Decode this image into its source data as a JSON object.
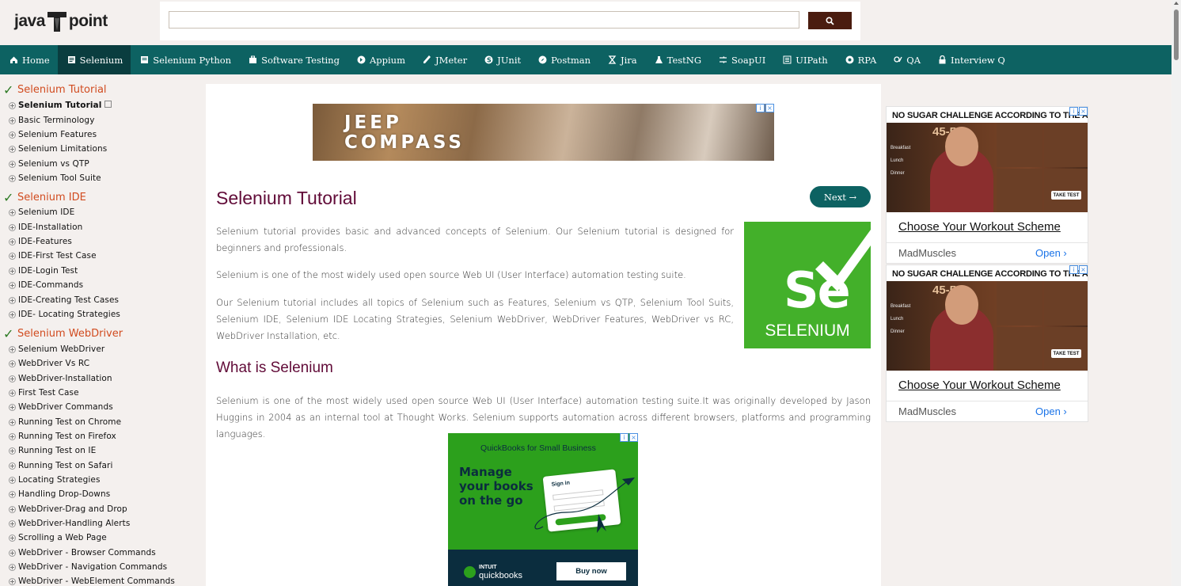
{
  "logo": {
    "left": "java",
    "right": "point"
  },
  "search": {
    "value": "",
    "placeholder": ""
  },
  "nav": [
    {
      "label": "Home",
      "icon": "home-icon"
    },
    {
      "label": "Selenium",
      "icon": "document-icon"
    },
    {
      "label": "Selenium Python",
      "icon": "document-icon"
    },
    {
      "label": "Software Testing",
      "icon": "briefcase-icon"
    },
    {
      "label": "Appium",
      "icon": "circle-arrow-icon"
    },
    {
      "label": "JMeter",
      "icon": "pen-icon"
    },
    {
      "label": "JUnit",
      "icon": "circle-s-icon"
    },
    {
      "label": "Postman",
      "icon": "compass-icon"
    },
    {
      "label": "Jira",
      "icon": "hourglass-icon"
    },
    {
      "label": "TestNG",
      "icon": "flask-icon"
    },
    {
      "label": "SoapUI",
      "icon": "shuffle-icon"
    },
    {
      "label": "UIPath",
      "icon": "list-icon"
    },
    {
      "label": "RPA",
      "icon": "gear-circle-icon"
    },
    {
      "label": "QA",
      "icon": "qa-icon"
    },
    {
      "label": "Interview Q",
      "icon": "lock-icon"
    }
  ],
  "sidebar": {
    "sections": [
      {
        "title": "Selenium Tutorial",
        "items": [
          "Selenium Tutorial",
          "Basic Terminology",
          "Selenium Features",
          "Selenium Limitations",
          "Selenium vs QTP",
          "Selenium Tool Suite"
        ]
      },
      {
        "title": "Selenium IDE",
        "items": [
          "Selenium IDE",
          "IDE-Installation",
          "IDE-Features",
          "IDE-First Test Case",
          "IDE-Login Test",
          "IDE-Commands",
          "IDE-Creating Test Cases",
          "IDE- Locating Strategies"
        ]
      },
      {
        "title": "Selenium WebDriver",
        "items": [
          "Selenium WebDriver",
          "WebDriver Vs RC",
          "WebDriver-Installation",
          "First Test Case",
          "WebDriver Commands",
          "Running Test on Chrome",
          "Running Test on Firefox",
          "Running Test on IE",
          "Running Test on Safari",
          "Locating Strategies",
          "Handling Drop-Downs",
          "WebDriver-Drag and Drop",
          "WebDriver-Handling Alerts",
          "Scrolling a Web Page",
          "WebDriver - Browser Commands",
          "WebDriver - Navigation Commands",
          "WebDriver - WebElement Commands"
        ]
      }
    ]
  },
  "main": {
    "ad_top": {
      "line1": "JEEP",
      "line2": "COMPASS"
    },
    "title": "Selenium Tutorial",
    "next_label": "Next →",
    "paragraphs": [
      "Selenium tutorial provides basic and advanced concepts of Selenium. Our Selenium tutorial is designed for beginners and professionals.",
      "Selenium is one of the most widely used open source Web UI (User Interface) automation testing suite.",
      "Our Selenium tutorial includes all topics of Selenium such as Features, Selenium vs QTP, Selenium Tool Suits, Selenium IDE, Selenium IDE Locating Strategies, Selenium WebDriver, WebDriver Features, WebDriver vs RC, WebDriver Installation, etc."
    ],
    "logo_mark": "Se",
    "logo_word": "SELENIUM",
    "subtitle": "What is Selenium",
    "paragraph_what": "Selenium is one of the most widely used open source Web UI (User Interface) automation testing suite.It was originally developed by Jason Huggins in 2004 as an internal tool at Thought Works. Selenium supports automation across different browsers, platforms and programming languages.",
    "ad_qb": {
      "top": "QuickBooks for Small Business",
      "headline": "Manage your books on the go",
      "card_title": "Sign in",
      "brand_line1": "INTUIT",
      "brand_line2": "quickbooks",
      "buy": "Buy now"
    }
  },
  "right_ads": [
    {
      "title": "NO SUGAR CHALLENGE ACCORDING TO THE AGE",
      "range": "45-55",
      "menu": [
        "Breakfast",
        "Lunch",
        "Dinner"
      ],
      "cta_badge": "TAKE TEST",
      "link": "Choose Your Workout Scheme",
      "brand": "MadMuscles",
      "open": "Open ›"
    },
    {
      "title": "NO SUGAR CHALLENGE ACCORDING TO THE AGE",
      "range": "45-55",
      "menu": [
        "Breakfast",
        "Lunch",
        "Dinner"
      ],
      "cta_badge": "TAKE TEST",
      "link": "Choose Your Workout Scheme",
      "brand": "MadMuscles",
      "open": "Open ›"
    }
  ],
  "colors": {
    "nav_bg": "#0d6262",
    "nav_active": "#0a3d3f",
    "heading": "#610b38",
    "section": "#d14b1f",
    "check": "#2c7a23",
    "selenium_green": "#43b02a"
  }
}
